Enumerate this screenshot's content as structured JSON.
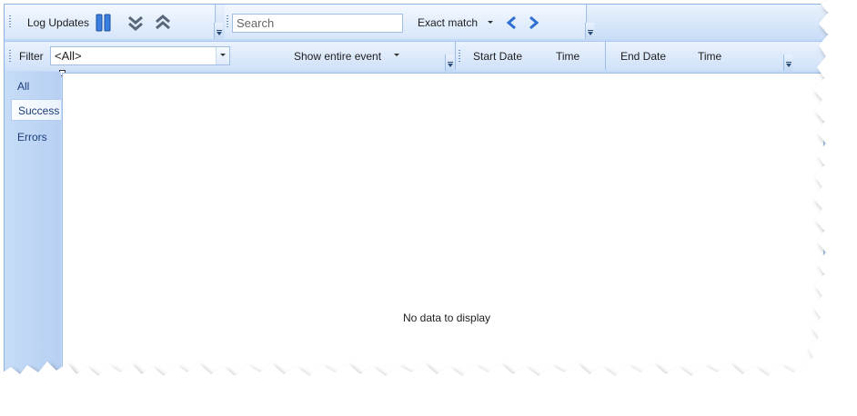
{
  "toolbar": {
    "log_updates_label": "Log Updates",
    "search_placeholder": "Search",
    "exact_match_label": "Exact match"
  },
  "filter_bar": {
    "filter_label": "Filter",
    "filter_value": "<All>",
    "show_entire_event_label": "Show entire event",
    "start_date_label": "Start Date",
    "start_time_label": "Time",
    "end_date_label": "End Date",
    "end_time_label": "Time"
  },
  "tabs": [
    {
      "label": "All"
    },
    {
      "label": "Success"
    },
    {
      "label": "Errors"
    }
  ],
  "content": {
    "empty_message": "No data to display"
  },
  "colors": {
    "toolbar_bg": "#d6e6fa",
    "accent_blue": "#2e6fd0",
    "tab_text": "#1c3c78"
  }
}
